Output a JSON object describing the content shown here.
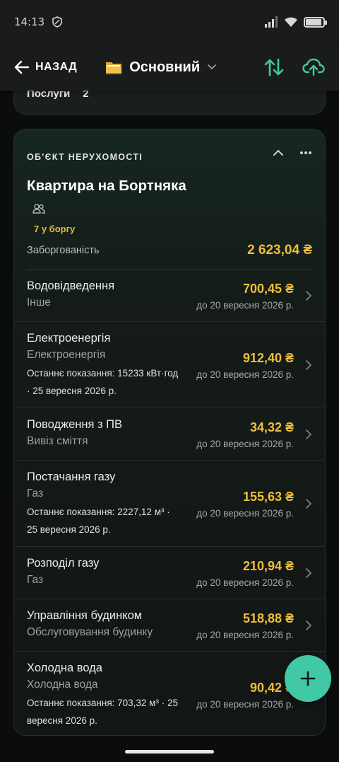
{
  "status_bar": {
    "time": "14:13",
    "battery_level": 0.9
  },
  "header": {
    "back_label": "НАЗАД",
    "budget_name": "Основний"
  },
  "partial_card": {
    "label": "Послуги",
    "count": "2"
  },
  "property": {
    "section_label": "ОБ'ЄКТ НЕРУХОМОСТІ",
    "title": "Квартира на Бортняка",
    "debt_count": "7 у боргу",
    "debt_label": "Заборгованість",
    "debt_total": "2 623,04 ₴"
  },
  "items": [
    {
      "name": "Водовідведення",
      "category": "Інше",
      "reading": "",
      "amount": "700,45 ₴",
      "due": "до 20 вересня 2026 р."
    },
    {
      "name": "Електроенергія",
      "category": "Електроенергія",
      "reading": "Останнє показання: 15233 кВт·год · 25 вересня 2026 р.",
      "amount": "912,40 ₴",
      "due": "до 20 вересня 2026 р."
    },
    {
      "name": "Поводження з ПВ",
      "category": "Вивіз сміття",
      "reading": "",
      "amount": "34,32 ₴",
      "due": "до 20 вересня 2026 р."
    },
    {
      "name": "Постачання газу",
      "category": "Газ",
      "reading": "Останнє показання: 2227,12 м³ · 25 вересня 2026 р.",
      "amount": "155,63 ₴",
      "due": "до 20 вересня 2026 р."
    },
    {
      "name": "Розподіл газу",
      "category": "Газ",
      "reading": "",
      "amount": "210,94 ₴",
      "due": "до 20 вересня 2026 р."
    },
    {
      "name": "Управління будинком",
      "category": "Обслуговування будинку",
      "reading": "",
      "amount": "518,88 ₴",
      "due": "до 20 вересня 2026 р."
    },
    {
      "name": "Холодна вода",
      "category": "Холодна вода",
      "reading": "Останнє показання: 703,32 м³ · 25 вересня 2026 р.",
      "amount": "90,42 ₴",
      "due": "до 20 вересня 2026 р."
    }
  ],
  "colors": {
    "accent": "#40c9a4",
    "amount": "#f0bd39",
    "background": "#0b0c0c"
  }
}
